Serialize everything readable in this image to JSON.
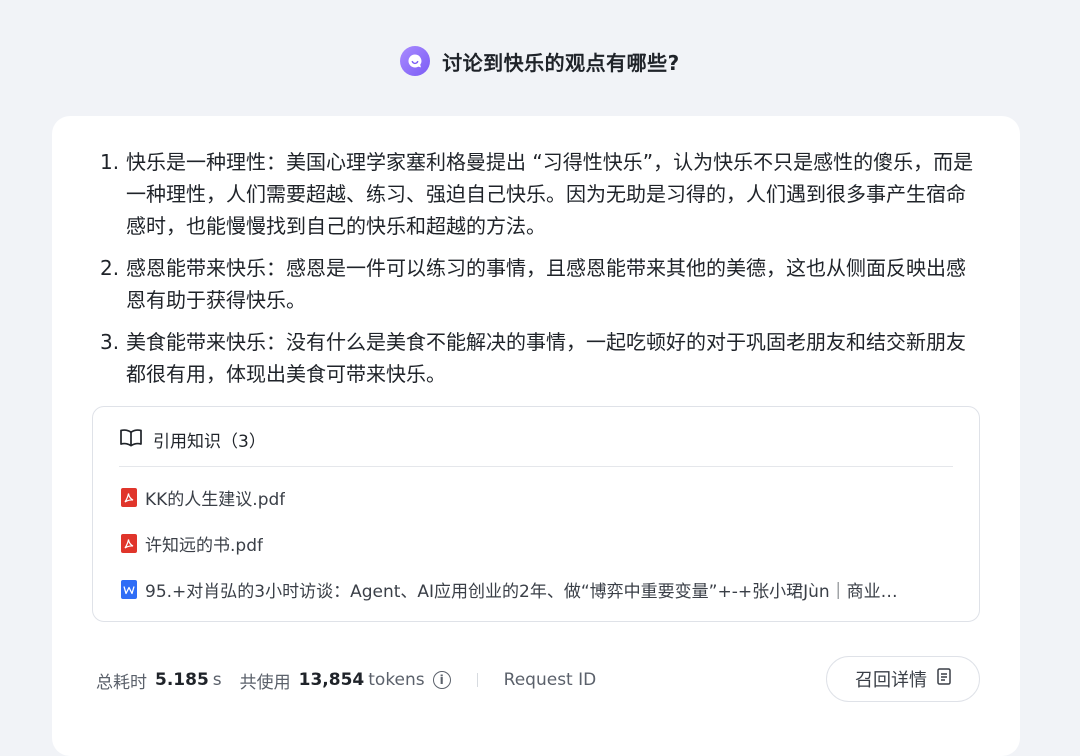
{
  "question": {
    "text": "讨论到快乐的观点有哪些?"
  },
  "answer": {
    "items": [
      {
        "num": "1.",
        "text": "快乐是一种理性：美国心理学家塞利格曼提出 “习得性快乐”，认为快乐不只是感性的傻乐，而是一种理性，人们需要超越、练习、强迫自己快乐。因为无助是习得的，人们遇到很多事产生宿命感时，也能慢慢找到自己的快乐和超越的方法。"
      },
      {
        "num": "2.",
        "text": "感恩能带来快乐：感恩是一件可以练习的事情，且感恩能带来其他的美德，这也从侧面反映出感恩有助于获得快乐。"
      },
      {
        "num": "3.",
        "text": "美食能带来快乐：没有什么是美食不能解决的事情，一起吃顿好的对于巩固老朋友和结交新朋友都很有用，体现出美食可带来快乐。"
      }
    ]
  },
  "references": {
    "title": "引用知识（3）",
    "items": [
      {
        "name": "KK的人生建议.pdf",
        "icon": "pdf-icon",
        "color": "#e0352b"
      },
      {
        "name": "许知远的书.pdf",
        "icon": "pdf-icon",
        "color": "#e0352b"
      },
      {
        "name": "95.+对肖弘的3小时访谈：Agent、AI应用创业的2年、做“博弈中重要变量”+-+张小珺Jùn｜商业…",
        "icon": "word-icon",
        "color": "#2f6df6"
      }
    ]
  },
  "footer": {
    "time_label": "总耗时",
    "time_value": "5.185",
    "time_unit": "s",
    "tokens_label": "共使用",
    "tokens_value": "13,854",
    "tokens_unit": "tokens",
    "request_id_label": "Request ID",
    "recall_button": "召回详情"
  },
  "colors": {
    "accent": "#7b5cf5",
    "pdf": "#e0352b",
    "word": "#2f6df6",
    "background": "#f1f3f7"
  }
}
